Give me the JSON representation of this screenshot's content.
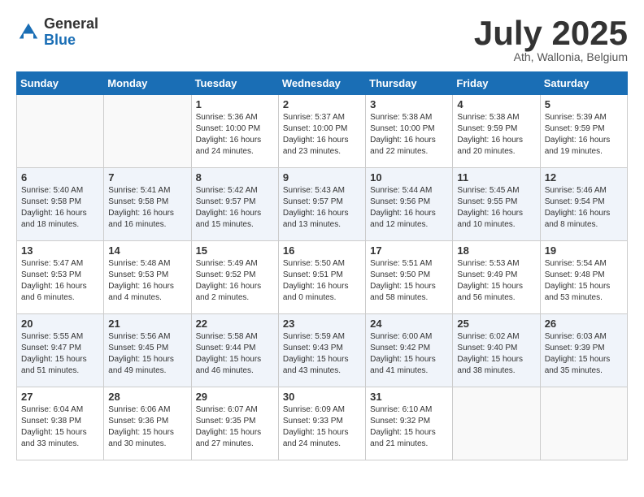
{
  "logo": {
    "general": "General",
    "blue": "Blue"
  },
  "title": "July 2025",
  "location": "Ath, Wallonia, Belgium",
  "weekdays": [
    "Sunday",
    "Monday",
    "Tuesday",
    "Wednesday",
    "Thursday",
    "Friday",
    "Saturday"
  ],
  "weeks": [
    [
      {
        "day": "",
        "info": ""
      },
      {
        "day": "",
        "info": ""
      },
      {
        "day": "1",
        "info": "Sunrise: 5:36 AM\nSunset: 10:00 PM\nDaylight: 16 hours\nand 24 minutes."
      },
      {
        "day": "2",
        "info": "Sunrise: 5:37 AM\nSunset: 10:00 PM\nDaylight: 16 hours\nand 23 minutes."
      },
      {
        "day": "3",
        "info": "Sunrise: 5:38 AM\nSunset: 10:00 PM\nDaylight: 16 hours\nand 22 minutes."
      },
      {
        "day": "4",
        "info": "Sunrise: 5:38 AM\nSunset: 9:59 PM\nDaylight: 16 hours\nand 20 minutes."
      },
      {
        "day": "5",
        "info": "Sunrise: 5:39 AM\nSunset: 9:59 PM\nDaylight: 16 hours\nand 19 minutes."
      }
    ],
    [
      {
        "day": "6",
        "info": "Sunrise: 5:40 AM\nSunset: 9:58 PM\nDaylight: 16 hours\nand 18 minutes."
      },
      {
        "day": "7",
        "info": "Sunrise: 5:41 AM\nSunset: 9:58 PM\nDaylight: 16 hours\nand 16 minutes."
      },
      {
        "day": "8",
        "info": "Sunrise: 5:42 AM\nSunset: 9:57 PM\nDaylight: 16 hours\nand 15 minutes."
      },
      {
        "day": "9",
        "info": "Sunrise: 5:43 AM\nSunset: 9:57 PM\nDaylight: 16 hours\nand 13 minutes."
      },
      {
        "day": "10",
        "info": "Sunrise: 5:44 AM\nSunset: 9:56 PM\nDaylight: 16 hours\nand 12 minutes."
      },
      {
        "day": "11",
        "info": "Sunrise: 5:45 AM\nSunset: 9:55 PM\nDaylight: 16 hours\nand 10 minutes."
      },
      {
        "day": "12",
        "info": "Sunrise: 5:46 AM\nSunset: 9:54 PM\nDaylight: 16 hours\nand 8 minutes."
      }
    ],
    [
      {
        "day": "13",
        "info": "Sunrise: 5:47 AM\nSunset: 9:53 PM\nDaylight: 16 hours\nand 6 minutes."
      },
      {
        "day": "14",
        "info": "Sunrise: 5:48 AM\nSunset: 9:53 PM\nDaylight: 16 hours\nand 4 minutes."
      },
      {
        "day": "15",
        "info": "Sunrise: 5:49 AM\nSunset: 9:52 PM\nDaylight: 16 hours\nand 2 minutes."
      },
      {
        "day": "16",
        "info": "Sunrise: 5:50 AM\nSunset: 9:51 PM\nDaylight: 16 hours\nand 0 minutes."
      },
      {
        "day": "17",
        "info": "Sunrise: 5:51 AM\nSunset: 9:50 PM\nDaylight: 15 hours\nand 58 minutes."
      },
      {
        "day": "18",
        "info": "Sunrise: 5:53 AM\nSunset: 9:49 PM\nDaylight: 15 hours\nand 56 minutes."
      },
      {
        "day": "19",
        "info": "Sunrise: 5:54 AM\nSunset: 9:48 PM\nDaylight: 15 hours\nand 53 minutes."
      }
    ],
    [
      {
        "day": "20",
        "info": "Sunrise: 5:55 AM\nSunset: 9:47 PM\nDaylight: 15 hours\nand 51 minutes."
      },
      {
        "day": "21",
        "info": "Sunrise: 5:56 AM\nSunset: 9:45 PM\nDaylight: 15 hours\nand 49 minutes."
      },
      {
        "day": "22",
        "info": "Sunrise: 5:58 AM\nSunset: 9:44 PM\nDaylight: 15 hours\nand 46 minutes."
      },
      {
        "day": "23",
        "info": "Sunrise: 5:59 AM\nSunset: 9:43 PM\nDaylight: 15 hours\nand 43 minutes."
      },
      {
        "day": "24",
        "info": "Sunrise: 6:00 AM\nSunset: 9:42 PM\nDaylight: 15 hours\nand 41 minutes."
      },
      {
        "day": "25",
        "info": "Sunrise: 6:02 AM\nSunset: 9:40 PM\nDaylight: 15 hours\nand 38 minutes."
      },
      {
        "day": "26",
        "info": "Sunrise: 6:03 AM\nSunset: 9:39 PM\nDaylight: 15 hours\nand 35 minutes."
      }
    ],
    [
      {
        "day": "27",
        "info": "Sunrise: 6:04 AM\nSunset: 9:38 PM\nDaylight: 15 hours\nand 33 minutes."
      },
      {
        "day": "28",
        "info": "Sunrise: 6:06 AM\nSunset: 9:36 PM\nDaylight: 15 hours\nand 30 minutes."
      },
      {
        "day": "29",
        "info": "Sunrise: 6:07 AM\nSunset: 9:35 PM\nDaylight: 15 hours\nand 27 minutes."
      },
      {
        "day": "30",
        "info": "Sunrise: 6:09 AM\nSunset: 9:33 PM\nDaylight: 15 hours\nand 24 minutes."
      },
      {
        "day": "31",
        "info": "Sunrise: 6:10 AM\nSunset: 9:32 PM\nDaylight: 15 hours\nand 21 minutes."
      },
      {
        "day": "",
        "info": ""
      },
      {
        "day": "",
        "info": ""
      }
    ]
  ]
}
